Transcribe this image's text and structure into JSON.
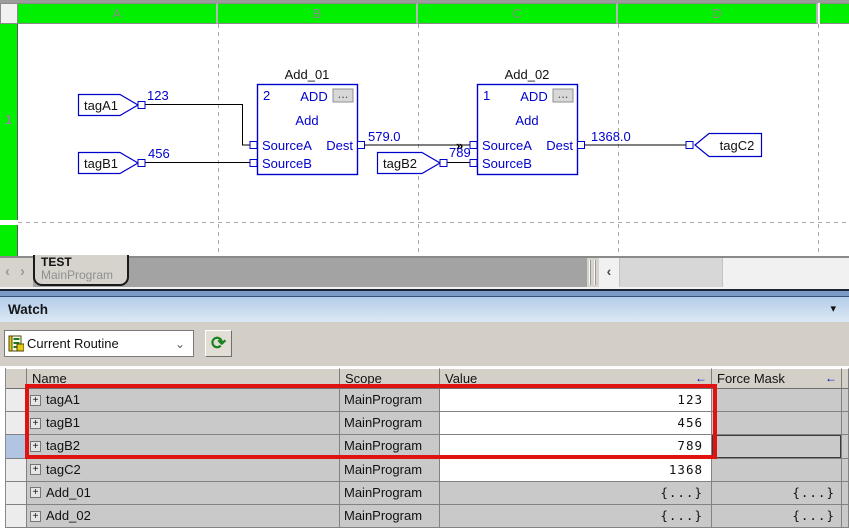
{
  "editor": {
    "column_headers": [
      "A",
      "B",
      "C",
      "D"
    ],
    "row_label": "1",
    "diagram": {
      "blocks": [
        {
          "title": "Add_01",
          "exec_order": "2",
          "mnemonic": "ADD",
          "operand": "Add",
          "pin_source_a": "SourceA",
          "pin_source_b": "SourceB",
          "pin_dest": "Dest"
        },
        {
          "title": "Add_02",
          "exec_order": "1",
          "mnemonic": "ADD",
          "operand": "Add",
          "pin_source_a": "SourceA",
          "pin_source_b": "SourceB",
          "pin_dest": "Dest"
        }
      ],
      "input_refs": [
        {
          "label": "tagA1",
          "value": "123"
        },
        {
          "label": "tagB1",
          "value": "456"
        },
        {
          "label": "tagB2",
          "value": "789"
        }
      ],
      "output_ref": {
        "label": "tagC2"
      },
      "wire_labels": {
        "add01_dest": "579.0",
        "add02_dest": "1368.0"
      }
    },
    "tab": {
      "sheet_title": "TEST",
      "routine": "MainProgram"
    }
  },
  "watch": {
    "title": "Watch",
    "scope_selector": "Current Routine",
    "table": {
      "headers": {
        "name": "Name",
        "scope": "Scope",
        "value": "Value",
        "force_mask": "Force Mask"
      },
      "rows": [
        {
          "name": "tagA1",
          "scope": "MainProgram",
          "value": "123",
          "force_mask": ""
        },
        {
          "name": "tagB1",
          "scope": "MainProgram",
          "value": "456",
          "force_mask": ""
        },
        {
          "name": "tagB2",
          "scope": "MainProgram",
          "value": "789",
          "force_mask": ""
        },
        {
          "name": "tagC2",
          "scope": "MainProgram",
          "value": "1368",
          "force_mask": ""
        },
        {
          "name": "Add_01",
          "scope": "MainProgram",
          "value": "{...}",
          "force_mask": "{...}"
        },
        {
          "name": "Add_02",
          "scope": "MainProgram",
          "value": "{...}",
          "force_mask": "{...}"
        }
      ]
    }
  },
  "icons": {
    "nav_left": "‹",
    "nav_right": "›",
    "scroll_left": "‹",
    "panel_dropdown": "▾",
    "combo_chevron": "⌄",
    "refresh": "⟳",
    "sort_arrow": "←",
    "expand": "+",
    "wire_junction": "»",
    "ellipsis": "..."
  },
  "colors": {
    "grid_green": "#00f000",
    "fbd_blue": "#0000cd",
    "highlight_red": "#e01212"
  }
}
